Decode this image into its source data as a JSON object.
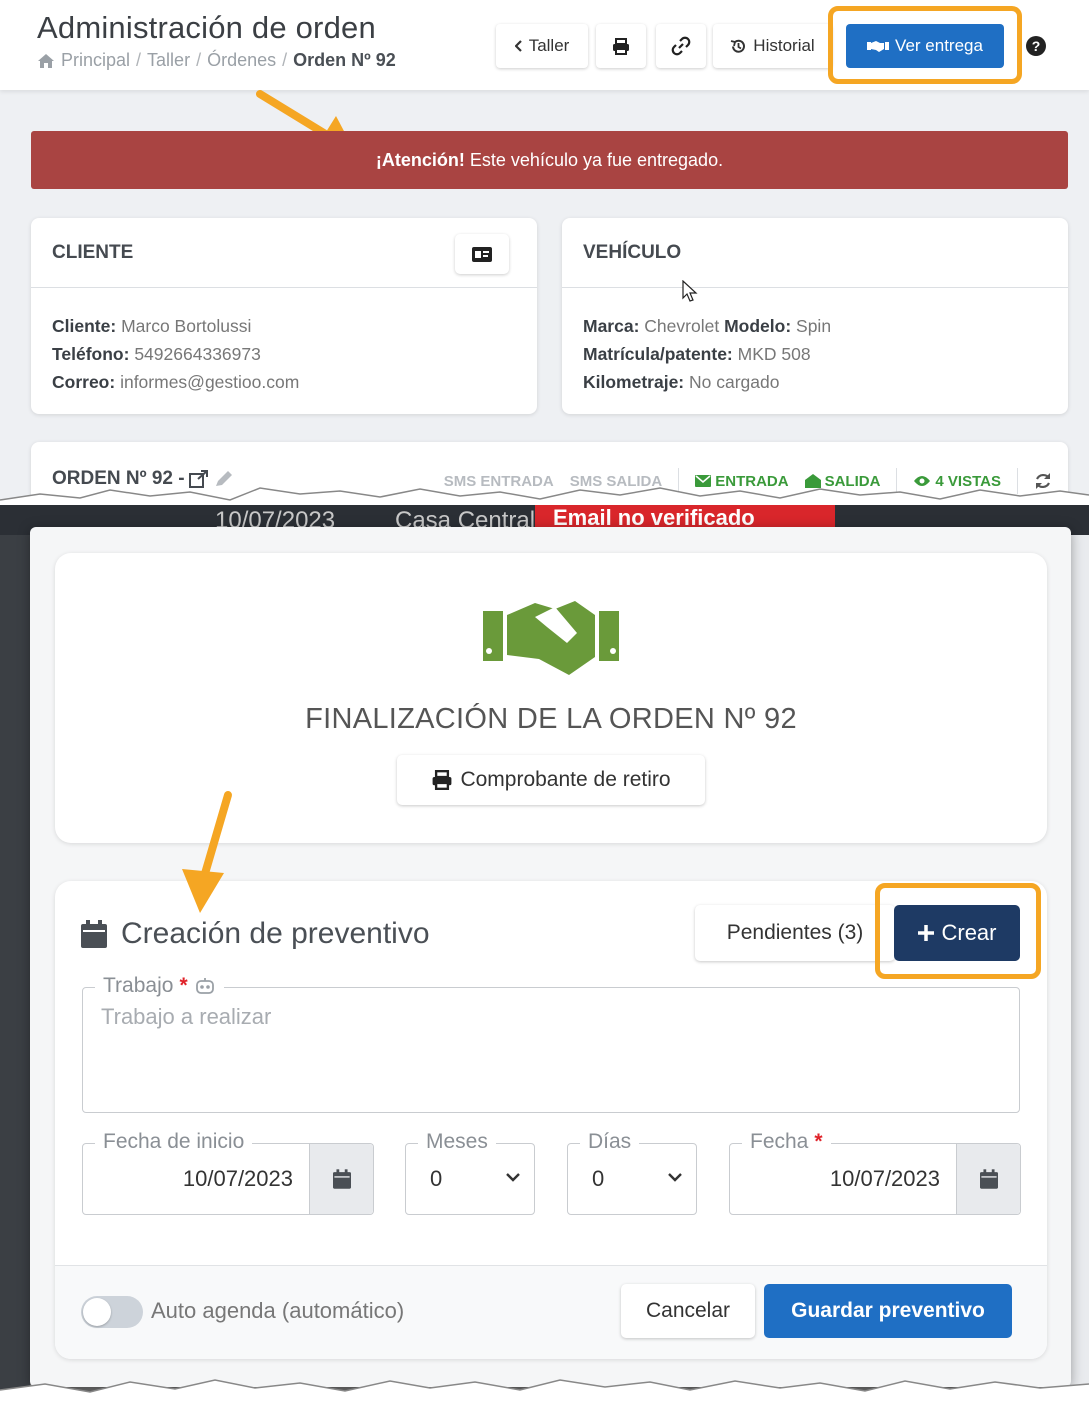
{
  "header": {
    "title": "Administración de orden",
    "breadcrumb": [
      "Principal",
      "Taller",
      "Órdenes",
      "Orden Nº 92"
    ],
    "toolbar": {
      "back_label": "Taller",
      "history_label": "Historial",
      "delivery_label": "Ver entrega"
    }
  },
  "alert": {
    "strong": "¡Atención!",
    "text": "Este vehículo ya fue entregado."
  },
  "client_card": {
    "heading": "CLIENTE",
    "rows": [
      {
        "label": "Cliente:",
        "value": "Marco Bortolussi"
      },
      {
        "label": "Teléfono:",
        "value": "5492664336973"
      },
      {
        "label": "Correo:",
        "value": "informes@gestioo.com"
      }
    ]
  },
  "vehicle_card": {
    "heading": "VEHÍCULO",
    "brand_label": "Marca:",
    "brand": "Chevrolet",
    "model_label": "Modelo:",
    "model": "Spin",
    "plate_label": "Matrícula/patente:",
    "plate": "MKD 508",
    "km_label": "Kilometraje:",
    "km": "No cargado"
  },
  "order_strip": {
    "title": "ORDEN Nº 92 -",
    "badges": {
      "sms_in": "SMS ENTRADA",
      "sms_out": "SMS SALIDA",
      "in": "ENTRADA",
      "out": "SALIDA",
      "views": "4 VISTAS"
    }
  },
  "background": {
    "date": "10/07/2023",
    "branch": "Casa Central",
    "email_warning": "Email no verificado"
  },
  "modal": {
    "final_title": "FINALIZACIÓN DE LA ORDEN Nº 92",
    "receipt_label": "Comprobante de retiro",
    "preventive": {
      "title": "Creación de preventivo",
      "pending_label": "Pendientes (3)",
      "create_label": "Crear",
      "work_label": "Trabajo",
      "work_placeholder": "Trabajo a realizar",
      "start_label": "Fecha de inicio",
      "start_value": "10/07/2023",
      "months_label": "Meses",
      "months_value": "0",
      "days_label": "Días",
      "days_value": "0",
      "date_label": "Fecha",
      "date_value": "10/07/2023",
      "auto_label": "Auto agenda (automático)",
      "cancel_label": "Cancelar",
      "save_label": "Guardar preventivo"
    }
  },
  "colors": {
    "accent": "#f5a623",
    "primary": "#1f6fc4",
    "dark_button": "#1e3a64",
    "danger": "#a94442",
    "success": "#6a9a3a"
  }
}
